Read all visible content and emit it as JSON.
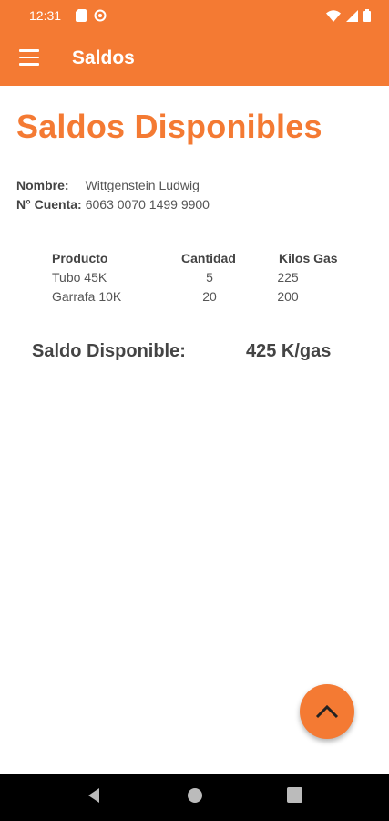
{
  "status_bar": {
    "time": "12:31"
  },
  "app_bar": {
    "title": "Saldos"
  },
  "page": {
    "title": "Saldos Disponibles",
    "nombre_label": "Nombre:",
    "nombre_value": "Wittgenstein Ludwig",
    "cuenta_label": "N° Cuenta:",
    "cuenta_value": "6063 0070 1499 9900"
  },
  "table": {
    "headers": [
      "Producto",
      "Cantidad",
      "Kilos Gas"
    ],
    "rows": [
      {
        "producto": "Tubo 45K",
        "cantidad": "5",
        "kilos": "225"
      },
      {
        "producto": "Garrafa 10K",
        "cantidad": "20",
        "kilos": "200"
      }
    ]
  },
  "saldo": {
    "label": "Saldo Disponible:",
    "value": "425 K/gas"
  },
  "colors": {
    "accent": "#F47A33"
  },
  "icons": [
    "menu-icon",
    "chevron-up-icon",
    "back-icon",
    "home-icon",
    "recents-icon",
    "wifi-icon",
    "signal-icon",
    "battery-icon",
    "sd-card-icon",
    "sync-icon"
  ]
}
